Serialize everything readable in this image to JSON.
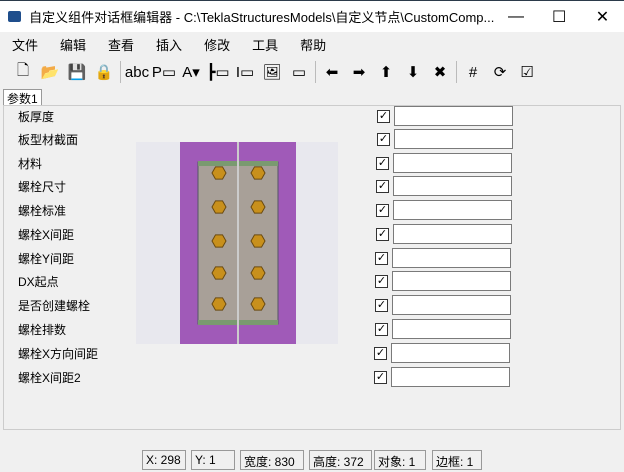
{
  "window": {
    "title": "自定义组件对话框编辑器 - C:\\TeklaStructuresModels\\自定义节点\\CustomComp...",
    "min": "—",
    "max": "☐",
    "close": "✕"
  },
  "menu": [
    "文件",
    "编辑",
    "查看",
    "插入",
    "修改",
    "工具",
    "帮助"
  ],
  "toolbar": [
    {
      "name": "new-icon",
      "g": "🗋"
    },
    {
      "name": "open-icon",
      "g": "📂"
    },
    {
      "name": "save-icon",
      "g": "💾"
    },
    {
      "name": "lock-icon",
      "g": "🔒"
    },
    {
      "name": "sep"
    },
    {
      "name": "text-label-icon",
      "g": "abc"
    },
    {
      "name": "parameter-field-icon",
      "g": "P▭"
    },
    {
      "name": "dropdown-icon",
      "g": "A▾"
    },
    {
      "name": "length-field-icon",
      "g": "┣▭"
    },
    {
      "name": "dimension-field-icon",
      "g": "I▭"
    },
    {
      "name": "image-icon",
      "g": "🖼"
    },
    {
      "name": "tab-page-icon",
      "g": "▭"
    },
    {
      "name": "sep"
    },
    {
      "name": "arrow-left-icon",
      "g": "⬅"
    },
    {
      "name": "arrow-right-icon",
      "g": "➡"
    },
    {
      "name": "move-up-icon",
      "g": "⬆"
    },
    {
      "name": "move-down-icon",
      "g": "⬇"
    },
    {
      "name": "delete-icon",
      "g": "✖"
    },
    {
      "name": "sep"
    },
    {
      "name": "grid-icon",
      "g": "#"
    },
    {
      "name": "refresh-icon",
      "g": "⟳"
    },
    {
      "name": "checkbox-toggle-icon",
      "g": "☑"
    }
  ],
  "tab": "参数1",
  "rows": [
    "板厚度",
    "板型材截面",
    "材料",
    "螺栓尺寸",
    "螺栓标准",
    "螺栓X间距",
    "螺栓Y间距",
    "DX起点",
    "是否创建螺栓",
    "螺栓排数",
    "螺栓X方向间距",
    "螺栓X间距2"
  ],
  "check": "✓",
  "status": [
    "X: 298",
    "Y: 1",
    "宽度: 830",
    "高度: 372",
    "对象: 1",
    "边框: 1"
  ]
}
